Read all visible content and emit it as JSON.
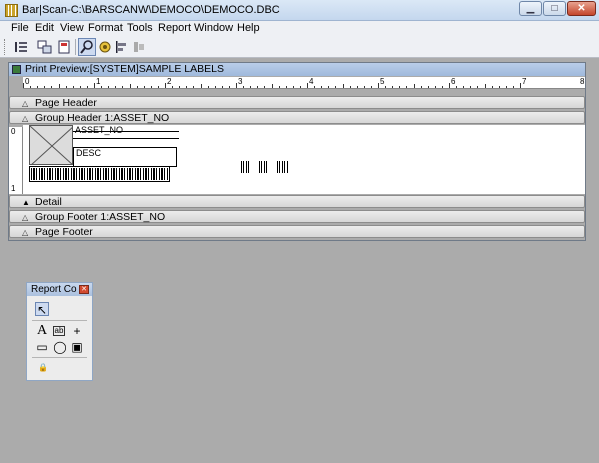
{
  "window": {
    "title": "Bar|Scan-C:\\BARSCANW\\DEMOCO\\DEMOCO.DBC",
    "min_glyph": "▁",
    "max_glyph": "□",
    "close_glyph": "✕"
  },
  "menu": [
    {
      "label": "File"
    },
    {
      "label": "Edit"
    },
    {
      "label": "View"
    },
    {
      "label": "Format"
    },
    {
      "label": "Tools"
    },
    {
      "label": "Report"
    },
    {
      "label": "Window"
    },
    {
      "label": "Help"
    }
  ],
  "toolbar": {
    "buttons": [
      "first-icon",
      "multi-page-icon",
      "page-icon",
      "zoom-tools-icon",
      "print-setup-icon",
      "align-icon",
      "disabled-tool-icon"
    ],
    "active_index": 3
  },
  "preview": {
    "title": "Print Preview:[SYSTEM]SAMPLE LABELS",
    "ruler_numbers": [
      "0",
      "1",
      "2",
      "3",
      "4",
      "5",
      "6",
      "7",
      "8"
    ],
    "vruler_numbers": [
      "0",
      "1"
    ],
    "bands": {
      "page_header": "Page Header",
      "group_header": "Group Header 1:ASSET_NO",
      "detail": "Detail",
      "group_footer": "Group Footer 1:ASSET_NO",
      "page_footer": "Page Footer"
    },
    "fields": {
      "asset_no": "ASSET_NO",
      "desc": "DESC"
    }
  },
  "palette": {
    "title": "Report Controls",
    "close_glyph": "✕",
    "tools": {
      "pointer": "↖",
      "label": "A",
      "field": "ab",
      "line": "+",
      "rectangle": "▭",
      "rounded": "◯",
      "picture": "▣",
      "lock": "🔒"
    }
  },
  "colors": {
    "background": "#ababab",
    "band": "#dcdcdc",
    "accent": "#6b86b3"
  }
}
